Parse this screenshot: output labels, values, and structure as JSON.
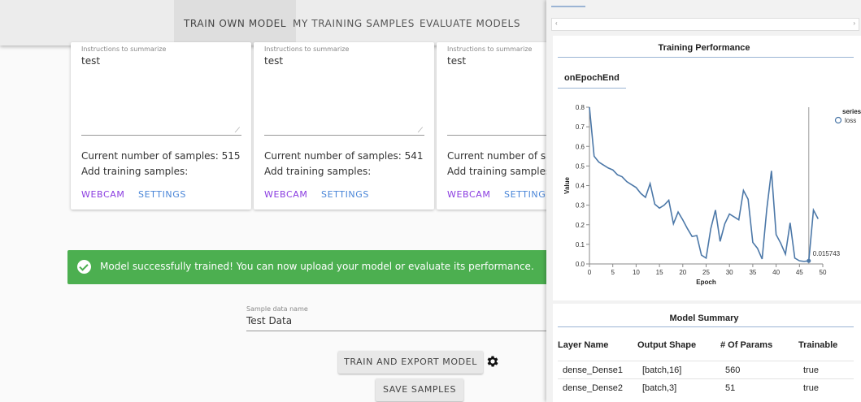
{
  "nav": {
    "tabs": [
      {
        "label": "TRAIN OWN MODEL"
      },
      {
        "label": "MY TRAINING SAMPLES"
      },
      {
        "label": "EVALUATE MODELS"
      }
    ]
  },
  "cards": [
    {
      "field_label": "Instructions to summarize",
      "field_value": "test",
      "count_text": "Current number of samples: 515",
      "add_text": "Add training samples:",
      "webcam": "WEBCAM",
      "settings": "SETTINGS"
    },
    {
      "field_label": "Instructions to summarize",
      "field_value": "test",
      "count_text": "Current number of samples: 541",
      "add_text": "Add training samples:",
      "webcam": "WEBCAM",
      "settings": "SETTINGS"
    },
    {
      "field_label": "Instructions to summarize",
      "field_value": "test",
      "count_text": "Current number of sam",
      "add_text": "Add training samples:",
      "webcam": "WEBCAM",
      "settings": "SETTINGS"
    }
  ],
  "alert": {
    "message": "Model successfully trained! You can now upload your model or evaluate its performance.",
    "color": "#4caf50"
  },
  "sample_name": {
    "label": "Sample data name",
    "value": "Test Data"
  },
  "buttons": {
    "train_export": "TRAIN AND EXPORT MODEL",
    "save_samples": "SAVE SAMPLES"
  },
  "panel": {
    "scroll_left": "‹",
    "scroll_right": "›",
    "performance_title": "Training Performance",
    "epoch_tab": "onEpochEnd",
    "summary_title": "Model Summary",
    "table": {
      "headers": [
        "Layer Name",
        "Output Shape",
        "# Of Params",
        "Trainable"
      ],
      "rows": [
        [
          "dense_Dense1",
          "[batch,16]",
          "560",
          "true"
        ],
        [
          "dense_Dense2",
          "[batch,3]",
          "51",
          "true"
        ]
      ]
    }
  },
  "chart_data": {
    "type": "line",
    "title": "",
    "xlabel": "Epoch",
    "ylabel": "Value",
    "xlim": [
      0,
      50
    ],
    "ylim": [
      0,
      0.8
    ],
    "x_ticks": [
      "0",
      "5",
      "10",
      "15",
      "20",
      "25",
      "30",
      "35",
      "40",
      "45",
      "50"
    ],
    "y_ticks": [
      "0.0",
      "0.1",
      "0.2",
      "0.3",
      "0.4",
      "0.5",
      "0.6",
      "0.7",
      "0.8"
    ],
    "legend_title": "series",
    "legend_position": "top-right",
    "series": [
      {
        "name": "loss",
        "color": "#4c78a8",
        "x": [
          0,
          1,
          2,
          3,
          4,
          5,
          6,
          7,
          8,
          9,
          10,
          11,
          12,
          13,
          14,
          15,
          16,
          17,
          18,
          19,
          20,
          21,
          22,
          23,
          24,
          25,
          26,
          27,
          28,
          29,
          30,
          31,
          32,
          33,
          34,
          35,
          36,
          37,
          38,
          39,
          40,
          41,
          42,
          43,
          44,
          45,
          46,
          47,
          48,
          49
        ],
        "values": [
          0.8,
          0.55,
          0.52,
          0.505,
          0.49,
          0.48,
          0.455,
          0.445,
          0.42,
          0.405,
          0.39,
          0.36,
          0.34,
          0.41,
          0.305,
          0.285,
          0.3,
          0.325,
          0.205,
          0.265,
          0.225,
          0.18,
          0.14,
          0.145,
          0.045,
          0.03,
          0.18,
          0.275,
          0.115,
          0.205,
          0.255,
          0.24,
          0.225,
          0.375,
          0.33,
          0.11,
          0.08,
          0.025,
          0.28,
          0.475,
          0.15,
          0.105,
          0.05,
          0.21,
          0.03,
          0.016,
          0.013,
          0.016,
          0.275,
          0.23
        ]
      }
    ],
    "annotation": {
      "label": "0.015743",
      "x": 47,
      "y": 0.015743
    }
  }
}
